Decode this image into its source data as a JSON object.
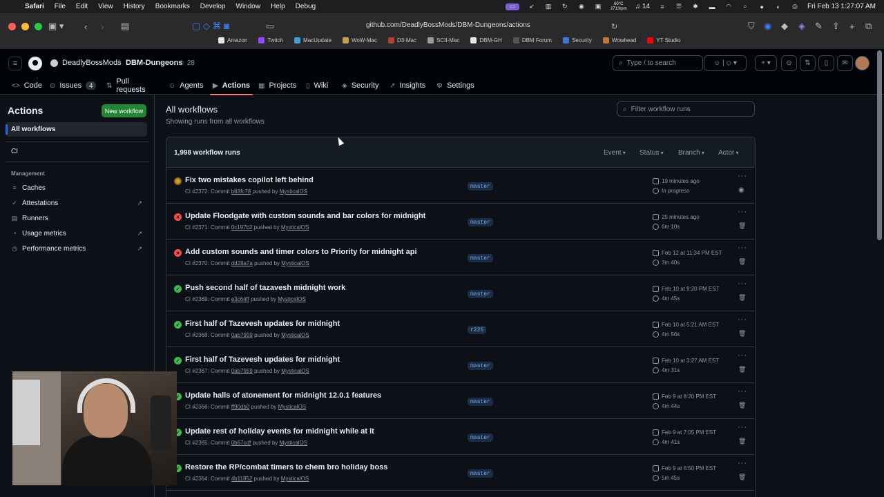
{
  "menubar": {
    "items": [
      "Safari",
      "File",
      "Edit",
      "View",
      "History",
      "Bookmarks",
      "Develop",
      "Window",
      "Help",
      "Debug"
    ],
    "weather_temp": "60°C",
    "weather_rpm": "2713rpm",
    "notifications_count": "14",
    "datetime": "Fri Feb 13  1:27:07 AM"
  },
  "browser": {
    "url": "github.com/DeadlyBossMods/DBM-Dungeons/actions",
    "bookmarks": [
      {
        "label": "Amazon",
        "color": "#e6e6e6"
      },
      {
        "label": "Twitch",
        "color": "#9146ff"
      },
      {
        "label": "MacUpdate",
        "color": "#3aa0d8"
      },
      {
        "label": "WoW-Mac",
        "color": "#c8a14a"
      },
      {
        "label": "D3-Mac",
        "color": "#b04030"
      },
      {
        "label": "SCII-Mac",
        "color": "#9a9a9a"
      },
      {
        "label": "DBM-GH",
        "color": "#e6e6e6"
      },
      {
        "label": "DBM Forum",
        "color": "#555555"
      },
      {
        "label": "Security",
        "color": "#3a7bd5"
      },
      {
        "label": "Wowhead",
        "color": "#c8762d"
      },
      {
        "label": "YT Studio",
        "color": "#ff0000"
      }
    ]
  },
  "repo": {
    "owner": "DeadlyBossMods",
    "separator": "/",
    "name": "DBM-Dungeons",
    "stars": "☆ 28"
  },
  "header": {
    "search_placeholder": "Type / to search"
  },
  "nav": {
    "tabs": [
      {
        "label": "Code",
        "icon": "<>"
      },
      {
        "label": "Issues",
        "icon": "⊙",
        "count": "4"
      },
      {
        "label": "Pull requests",
        "icon": "⇅"
      },
      {
        "label": "Agents",
        "icon": "☺"
      },
      {
        "label": "Actions",
        "icon": "▶",
        "active": true
      },
      {
        "label": "Projects",
        "icon": "▦"
      },
      {
        "label": "Wiki",
        "icon": "▯"
      },
      {
        "label": "Security",
        "icon": "◈"
      },
      {
        "label": "Insights",
        "icon": "↗"
      },
      {
        "label": "Settings",
        "icon": "⚙"
      }
    ]
  },
  "sidebar": {
    "title": "Actions",
    "new_workflow": "New workflow",
    "all_workflows": "All workflows",
    "workflows": [
      "CI"
    ],
    "management_heading": "Management",
    "management_items": [
      {
        "label": "Caches",
        "icon": "≡",
        "external": false
      },
      {
        "label": "Attestations",
        "icon": "✓",
        "external": true
      },
      {
        "label": "Runners",
        "icon": "▤",
        "external": false
      },
      {
        "label": "Usage metrics",
        "icon": "◔",
        "external": true
      },
      {
        "label": "Performance metrics",
        "icon": "◷",
        "external": true
      }
    ],
    "external_glyph": "↗"
  },
  "main": {
    "title": "All workflows",
    "subtitle": "Showing runs from all workflows",
    "filter_placeholder": "Filter workflow runs",
    "runs_count": "1,998 workflow runs",
    "filters": [
      "Event",
      "Status",
      "Branch",
      "Actor"
    ]
  },
  "runs": [
    {
      "title": "Fix two mistakes copilot left behind",
      "workflow": "CI",
      "number": "#2372",
      "commit": "b83fc78",
      "actor": "MysticalOS",
      "branch": "master",
      "date": "19 minutes ago",
      "duration": "In progress",
      "status": "progress"
    },
    {
      "title": "Update Floodgate with custom sounds and bar colors for midnight",
      "workflow": "CI",
      "number": "#2371",
      "commit": "0c197b2",
      "actor": "MysticalOS",
      "branch": "master",
      "date": "25 minutes ago",
      "duration": "6m 10s",
      "status": "failure"
    },
    {
      "title": "Add custom sounds and timer colors to Priority for midnight api",
      "workflow": "CI",
      "number": "#2370",
      "commit": "dd28a7a",
      "actor": "MysticalOS",
      "branch": "master",
      "date": "Feb 12 at 11:34 PM EST",
      "duration": "3m 40s",
      "status": "failure"
    },
    {
      "title": "Push second half of tazavesh midnight work",
      "workflow": "CI",
      "number": "#2369",
      "commit": "e3c64ff",
      "actor": "MysticalOS",
      "branch": "master",
      "date": "Feb 10 at 9:20 PM EST",
      "duration": "4m 45s",
      "status": "success"
    },
    {
      "title": "First half of Tazevesh updates for midnight",
      "workflow": "CI",
      "number": "#2368",
      "commit": "0ab7959",
      "actor": "MysticalOS",
      "branch": "r225",
      "date": "Feb 10 at 5:21 AM EST",
      "duration": "4m 56s",
      "status": "success"
    },
    {
      "title": "First half of Tazevesh updates for midnight",
      "workflow": "CI",
      "number": "#2367",
      "commit": "0ab7959",
      "actor": "MysticalOS",
      "branch": "master",
      "date": "Feb 10 at 3:27 AM EST",
      "duration": "4m 31s",
      "status": "success"
    },
    {
      "title": "Update halls of atonement for midnight 12.0.1 features",
      "workflow": "CI",
      "number": "#2366",
      "commit": "ff90db0",
      "actor": "MysticalOS",
      "branch": "master",
      "date": "Feb 9 at 8:20 PM EST",
      "duration": "4m 44s",
      "status": "success"
    },
    {
      "title": "Update rest of holiday events for midnight while at it",
      "workflow": "CI",
      "number": "#2365",
      "commit": "0b67cdf",
      "actor": "MysticalOS",
      "branch": "master",
      "date": "Feb 9 at 7:05 PM EST",
      "duration": "4m 41s",
      "status": "success"
    },
    {
      "title": "Restore the RP/combat timers to chem bro holiday boss",
      "workflow": "CI",
      "number": "#2364",
      "commit": "4b11852",
      "actor": "MysticalOS",
      "branch": "master",
      "date": "Feb 9 at 6:50 PM EST",
      "duration": "5m 45s",
      "status": "success"
    }
  ],
  "labels": {
    "commit_word": "Commit",
    "pushed_by": "pushed by",
    "status_glyph_success": "✓",
    "status_glyph_failure": "✕",
    "status_glyph_progress": ""
  },
  "colors": {
    "success": "#3fb950",
    "failure": "#f85149",
    "in_progress": "#d29922",
    "primary_button": "#238636",
    "accent_underline": "#f78166"
  }
}
